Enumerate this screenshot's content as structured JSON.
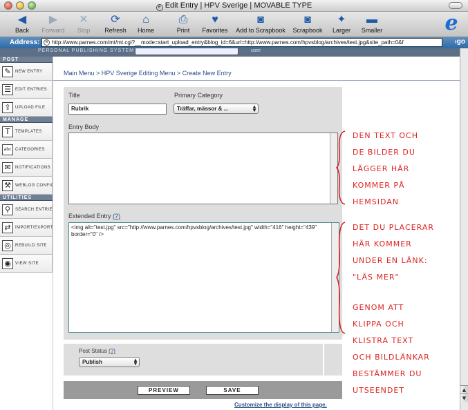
{
  "window": {
    "title": "Edit Entry | HPV Sverige | MOVABLE TYPE"
  },
  "toolbar": {
    "back": "Back",
    "forward": "Forward",
    "stop": "Stop",
    "refresh": "Refresh",
    "home": "Home",
    "print": "Print",
    "favorites": "Favorites",
    "add_to_scrapbook": "Add to Scrapbook",
    "scrapbook": "Scrapbook",
    "larger": "Larger",
    "smaller": "Smaller"
  },
  "address": {
    "label": "Address:",
    "url": "http://www.parnes.com/mt/mt.cgi?__mode=start_upload_entry&blog_id=6&url=http://www.parnes.com/hpvsblog/archives/test.jpg&site_path=0&f",
    "go": "go"
  },
  "header_strip": {
    "text": "PERSONAL PUBLISHING SYSTEM",
    "user": "user:"
  },
  "sidebar": {
    "sections": [
      {
        "heading": "POST",
        "items": [
          {
            "label": "NEW ENTRY",
            "icon": "new-entry-icon",
            "glyph": "✎"
          },
          {
            "label": "EDIT ENTRIES",
            "icon": "edit-entries-icon",
            "glyph": "☰"
          },
          {
            "label": "UPLOAD FILE",
            "icon": "upload-file-icon",
            "glyph": "⇪"
          }
        ]
      },
      {
        "heading": "MANAGE",
        "items": [
          {
            "label": "TEMPLATES",
            "icon": "templates-icon",
            "glyph": "T"
          },
          {
            "label": "CATEGORIES",
            "icon": "categories-icon",
            "glyph": "abc"
          },
          {
            "label": "NOTIFICATIONS",
            "icon": "notifications-icon",
            "glyph": "✉"
          },
          {
            "label": "WEBLOG CONFIG",
            "icon": "weblog-config-icon",
            "glyph": "⚒"
          }
        ]
      },
      {
        "heading": "UTILITIES",
        "items": [
          {
            "label": "SEARCH ENTRIES",
            "icon": "search-entries-icon",
            "glyph": "⚲"
          },
          {
            "label": "IMPORT/EXPORT",
            "icon": "import-export-icon",
            "glyph": "⇄"
          },
          {
            "label": "REBUILD SITE",
            "icon": "rebuild-site-icon",
            "glyph": "◎"
          },
          {
            "label": "VIEW SITE",
            "icon": "view-site-icon",
            "glyph": "◉"
          }
        ]
      }
    ]
  },
  "main": {
    "breadcrumb": "Main Menu > HPV Sverige Editing Menu > Create New Entry",
    "title_label": "Title",
    "title_value": "Rubrik",
    "category_label": "Primary Category",
    "category_value": "Träffar, mässor & ...",
    "entry_body_label": "Entry Body",
    "entry_body_value": "",
    "extended_label": "Extended Entry",
    "help_mark": "(?)",
    "extended_value": "<img alt=\"test.jpg\" src=\"http://www.parnes.com/hpvsblog/archives/test.jpg\" width=\"416\" height=\"439\" border=\"0\" />",
    "post_status_label": "Post Status",
    "post_status_value": "Publish",
    "preview_button": "PREVIEW",
    "save_button": "SAVE",
    "customize_link": "Customize the display of this page."
  },
  "annotations": {
    "note1": "DEN TEXT OCH\nDE BILDER DU\nLÄGGER HÄR\nKOMMER PÅ\nHEMSIDAN",
    "note2": "DET DU PLACERAR\nHÄR KOMMER\nUNDER EN LÄNK:\n\"LÄS MER\"",
    "note3": "GENOM ATT\nKLIPPA OCH\nKLISTRA TEXT\nOCH BILDLÄNKAR\nBESTÄMMER DU\nUTSEENDET",
    "color": "#d22222"
  }
}
